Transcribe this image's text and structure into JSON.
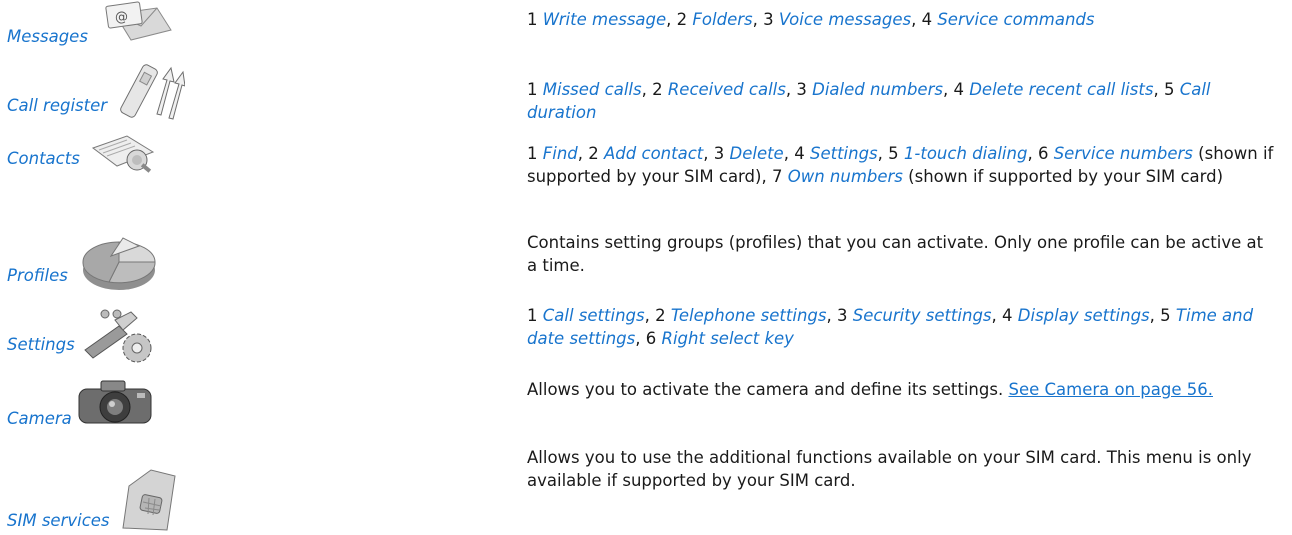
{
  "rows": [
    {
      "name": "Messages",
      "items": [
        {
          "n": "1",
          "label": "Write message"
        },
        {
          "n": "2",
          "label": "Folders"
        },
        {
          "n": "3",
          "label": "Voice messages"
        },
        {
          "n": "4",
          "label": "Service commands"
        }
      ]
    },
    {
      "name": "Call register",
      "items": [
        {
          "n": "1",
          "label": "Missed calls"
        },
        {
          "n": "2",
          "label": "Received calls"
        },
        {
          "n": "3",
          "label": "Dialed numbers"
        },
        {
          "n": "4",
          "label": "Delete recent call lists"
        },
        {
          "n": "5",
          "label": "Call duration"
        }
      ]
    },
    {
      "name": "Contacts",
      "items": [
        {
          "n": "1",
          "label": "Find"
        },
        {
          "n": "2",
          "label": "Add contact"
        },
        {
          "n": "3",
          "label": "Delete"
        },
        {
          "n": "4",
          "label": "Settings"
        },
        {
          "n": "5",
          "label": "1-touch dialing"
        },
        {
          "n": "6",
          "label": "Service numbers"
        },
        {
          "n": "7",
          "label": "Own numbers"
        }
      ],
      "note_shown_if_supported": "(shown if supported by your SIM card)"
    },
    {
      "name": "Profiles",
      "text": "Contains setting groups (profiles) that you can activate. Only one profile can be active at a time."
    },
    {
      "name": "Settings",
      "items": [
        {
          "n": "1",
          "label": "Call settings"
        },
        {
          "n": "2",
          "label": "Telephone settings"
        },
        {
          "n": "3",
          "label": "Security settings"
        },
        {
          "n": "4",
          "label": "Display settings"
        },
        {
          "n": "5",
          "label": "Time and date settings"
        },
        {
          "n": "6",
          "label": "Right select key"
        }
      ]
    },
    {
      "name": "Camera",
      "text": "Allows you to activate the camera and define its settings.",
      "link": "See Camera on page 56."
    },
    {
      "name": "SIM services",
      "text": "Allows you to use the additional functions available on your SIM card. This menu is only available if supported by your SIM card."
    }
  ],
  "icons": [
    "envelope-icon",
    "phone-arrows-icon",
    "address-book-icon",
    "pie-chart-icon",
    "tools-gear-icon",
    "camera-icon",
    "sim-card-icon"
  ],
  "colors": {
    "link": "#1874cd",
    "text": "#1a1a1a"
  }
}
